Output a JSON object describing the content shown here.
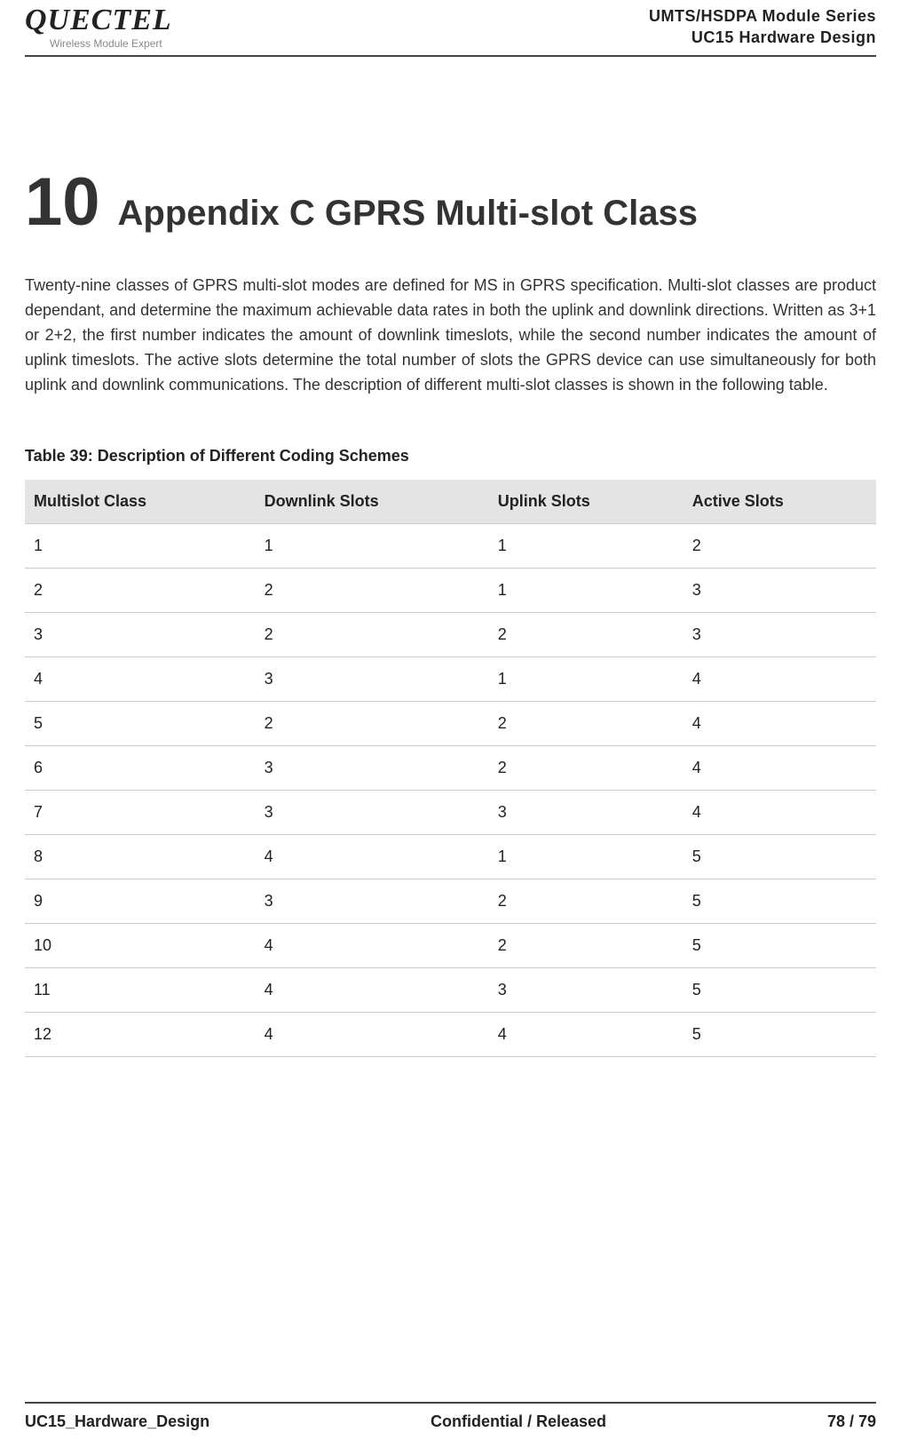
{
  "header": {
    "logo_word": "QUECTEL",
    "logo_sub": "Wireless Module Expert",
    "line1": "UMTS/HSDPA Module Series",
    "line2": "UC15 Hardware Design"
  },
  "chapter": {
    "number": "10",
    "title": "Appendix C GPRS Multi-slot Class"
  },
  "paragraph": "Twenty-nine classes of GPRS multi-slot modes are defined for MS in GPRS specification. Multi-slot classes are product dependant, and determine the maximum achievable data rates in both the uplink and downlink directions. Written as 3+1 or 2+2, the first number indicates the amount of downlink timeslots, while the second number indicates the amount of uplink timeslots. The active slots determine the total number of slots the GPRS device can use simultaneously for both uplink and downlink communications. The description of different multi-slot classes is shown in the following table.",
  "table": {
    "caption": "Table 39: Description of Different Coding Schemes",
    "headers": [
      "Multislot Class",
      "Downlink Slots",
      "Uplink Slots",
      "Active Slots"
    ],
    "rows": [
      [
        "1",
        "1",
        "1",
        "2"
      ],
      [
        "2",
        "2",
        "1",
        "3"
      ],
      [
        "3",
        "2",
        "2",
        "3"
      ],
      [
        "4",
        "3",
        "1",
        "4"
      ],
      [
        "5",
        "2",
        "2",
        "4"
      ],
      [
        "6",
        "3",
        "2",
        "4"
      ],
      [
        "7",
        "3",
        "3",
        "4"
      ],
      [
        "8",
        "4",
        "1",
        "5"
      ],
      [
        "9",
        "3",
        "2",
        "5"
      ],
      [
        "10",
        "4",
        "2",
        "5"
      ],
      [
        "11",
        "4",
        "3",
        "5"
      ],
      [
        "12",
        "4",
        "4",
        "5"
      ]
    ]
  },
  "footer": {
    "left": "UC15_Hardware_Design",
    "center": "Confidential / Released",
    "right": "78 / 79"
  },
  "chart_data": {
    "type": "table",
    "title": "Table 39: Description of Different Coding Schemes",
    "columns": [
      "Multislot Class",
      "Downlink Slots",
      "Uplink Slots",
      "Active Slots"
    ],
    "rows": [
      [
        1,
        1,
        1,
        2
      ],
      [
        2,
        2,
        1,
        3
      ],
      [
        3,
        2,
        2,
        3
      ],
      [
        4,
        3,
        1,
        4
      ],
      [
        5,
        2,
        2,
        4
      ],
      [
        6,
        3,
        2,
        4
      ],
      [
        7,
        3,
        3,
        4
      ],
      [
        8,
        4,
        1,
        5
      ],
      [
        9,
        3,
        2,
        5
      ],
      [
        10,
        4,
        2,
        5
      ],
      [
        11,
        4,
        3,
        5
      ],
      [
        12,
        4,
        4,
        5
      ]
    ]
  }
}
